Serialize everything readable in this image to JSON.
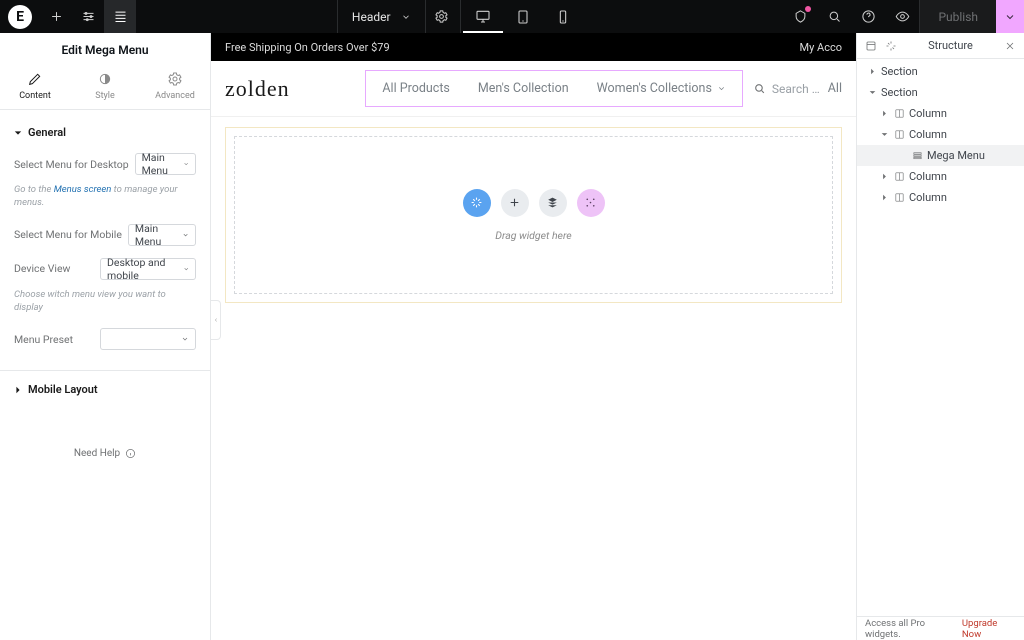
{
  "topbar": {
    "header_label": "Header",
    "publish_label": "Publish"
  },
  "left_panel": {
    "title": "Edit Mega Menu",
    "tabs": {
      "content": "Content",
      "style": "Style",
      "advanced": "Advanced"
    },
    "sections": {
      "general": "General",
      "mobile_layout": "Mobile Layout"
    },
    "fields": {
      "menu_desktop_label": "Select Menu for Desktop",
      "menu_desktop_value": "Main Menu",
      "menu_desktop_hint_pre": "Go to the ",
      "menu_desktop_hint_link": "Menus screen",
      "menu_desktop_hint_post": " to manage your menus.",
      "menu_mobile_label": "Select Menu for Mobile",
      "menu_mobile_value": "Main Menu",
      "device_view_label": "Device View",
      "device_view_value": "Desktop and mobile",
      "device_view_hint": "Choose witch menu view you want to display",
      "menu_preset_label": "Menu Preset",
      "menu_preset_value": ""
    },
    "need_help": "Need Help"
  },
  "canvas": {
    "announce_left": "Free Shipping On Orders Over $79",
    "announce_right": "My Acco",
    "brand": "zolden",
    "nav": {
      "all_products": "All Products",
      "mens": "Men's Collection",
      "womens": "Women's Collections"
    },
    "search_placeholder": "Search …",
    "nav_extra": "All",
    "drop_hint": "Drag widget here"
  },
  "structure": {
    "title": "Structure",
    "items": [
      {
        "label": "Section",
        "depth": 1,
        "expanded": false,
        "icon": "section"
      },
      {
        "label": "Section",
        "depth": 1,
        "expanded": true,
        "icon": "section"
      },
      {
        "label": "Column",
        "depth": 2,
        "expanded": false,
        "icon": "column"
      },
      {
        "label": "Column",
        "depth": 2,
        "expanded": true,
        "icon": "column"
      },
      {
        "label": "Mega Menu",
        "depth": 3,
        "expanded": null,
        "icon": "widget",
        "selected": true
      },
      {
        "label": "Column",
        "depth": 2,
        "expanded": false,
        "icon": "column"
      },
      {
        "label": "Column",
        "depth": 2,
        "expanded": false,
        "icon": "column"
      }
    ],
    "footer_text": "Access all Pro widgets.",
    "footer_link": "Upgrade Now"
  }
}
